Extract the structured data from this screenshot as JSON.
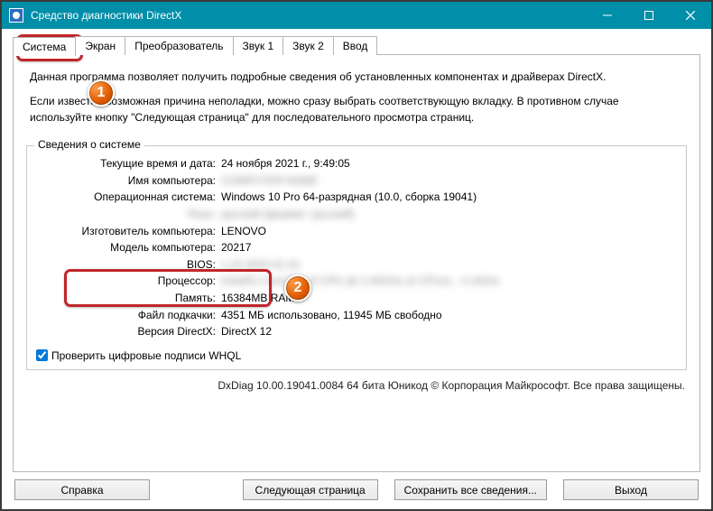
{
  "window": {
    "title": "Средство диагностики DirectX"
  },
  "tabs": {
    "system": "Система",
    "display": "Экран",
    "render": "Преобразователь",
    "sound1": "Звук 1",
    "sound2": "Звук 2",
    "input": "Ввод"
  },
  "intro": {
    "p1": "Данная программа позволяет получить подробные сведения об установленных компонентах и драйверах DirectX.",
    "p2": "Если известна возможная причина неполадки, можно сразу выбрать соответствующую вкладку. В противном случае используйте кнопку \"Следующая страница\" для последовательного просмотра страниц."
  },
  "group": {
    "title": "Сведения о системе"
  },
  "labels": {
    "datetime": "Текущие время и дата:",
    "computername": "Имя компьютера:",
    "os": "Операционная система:",
    "lang": "Язык:",
    "manufacturer": "Изготовитель компьютера:",
    "model": "Модель компьютера:",
    "bios": "BIOS:",
    "processor": "Процессор:",
    "memory": "Память:",
    "pagefile": "Файл подкачки:",
    "directx": "Версия DirectX:"
  },
  "values": {
    "datetime": "24 ноября 2021 г., 9:49:05",
    "computername": "",
    "os": "Windows 10 Pro 64-разрядная (10.0, сборка 19041)",
    "lang": "русский (формат: русский)",
    "manufacturer": "LENOVO",
    "model": "20217",
    "bios": "",
    "processor": "",
    "memory": "16384MB RAM",
    "pagefile": "4351 МБ использовано, 11945 МБ свободно",
    "directx": "DirectX 12"
  },
  "whql_label": "Проверить цифровые подписи WHQL",
  "footer": "DxDiag 10.00.19041.0084 64 бита Юникод © Корпорация Майкрософт. Все права защищены.",
  "buttons": {
    "help": "Справка",
    "next": "Следующая страница",
    "save": "Сохранить все сведения...",
    "exit": "Выход"
  },
  "annotations": {
    "b1": "1",
    "b2": "2"
  }
}
